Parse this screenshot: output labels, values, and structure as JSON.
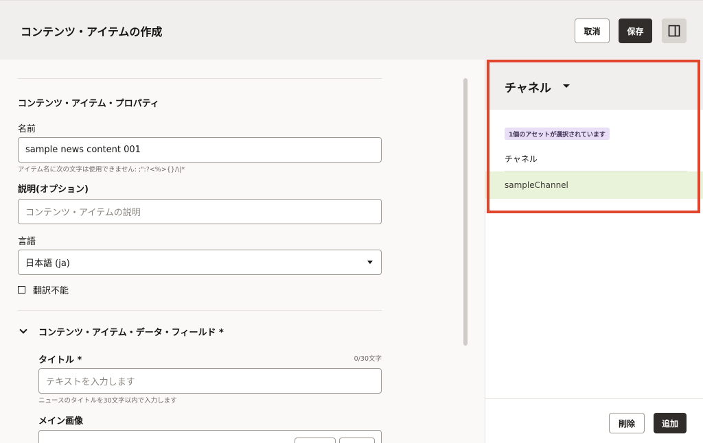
{
  "header": {
    "title": "コンテンツ・アイテムの作成",
    "cancel_label": "取消",
    "save_label": "保存"
  },
  "form": {
    "section_title": "コンテンツ・アイテム・プロパティ",
    "name_label": "名前",
    "name_value": "sample news content 001",
    "name_hint": "アイテム名に次の文字は使用できません: ;\":?<%>{}/\\|*",
    "description_label": "説明(オプション)",
    "description_placeholder": "コンテンツ・アイテムの説明",
    "language_label": "言語",
    "language_value": "日本語 (ja)",
    "non_translatable_label": "翻訳不能",
    "data_fields_title": "コンテンツ・アイテム・データ・フィールド *",
    "title_field_label": "タイトル *",
    "title_counter": "0/30文字",
    "title_placeholder": "テキストを入力します",
    "title_hint": "ニュースのタイトルを30文字以内で入力します",
    "main_image_label": "メイン画像"
  },
  "panel": {
    "title": "チャネル",
    "badge": "1個のアセットが選択されています",
    "list_header": "チャネル",
    "items": [
      {
        "label": "sampleChannel"
      }
    ],
    "delete_label": "削除",
    "add_label": "追加"
  },
  "colors": {
    "highlight": "#e1452b",
    "selected_row": "#e8f3da",
    "badge_bg": "#e8dff6",
    "primary_button": "#312d2a"
  }
}
